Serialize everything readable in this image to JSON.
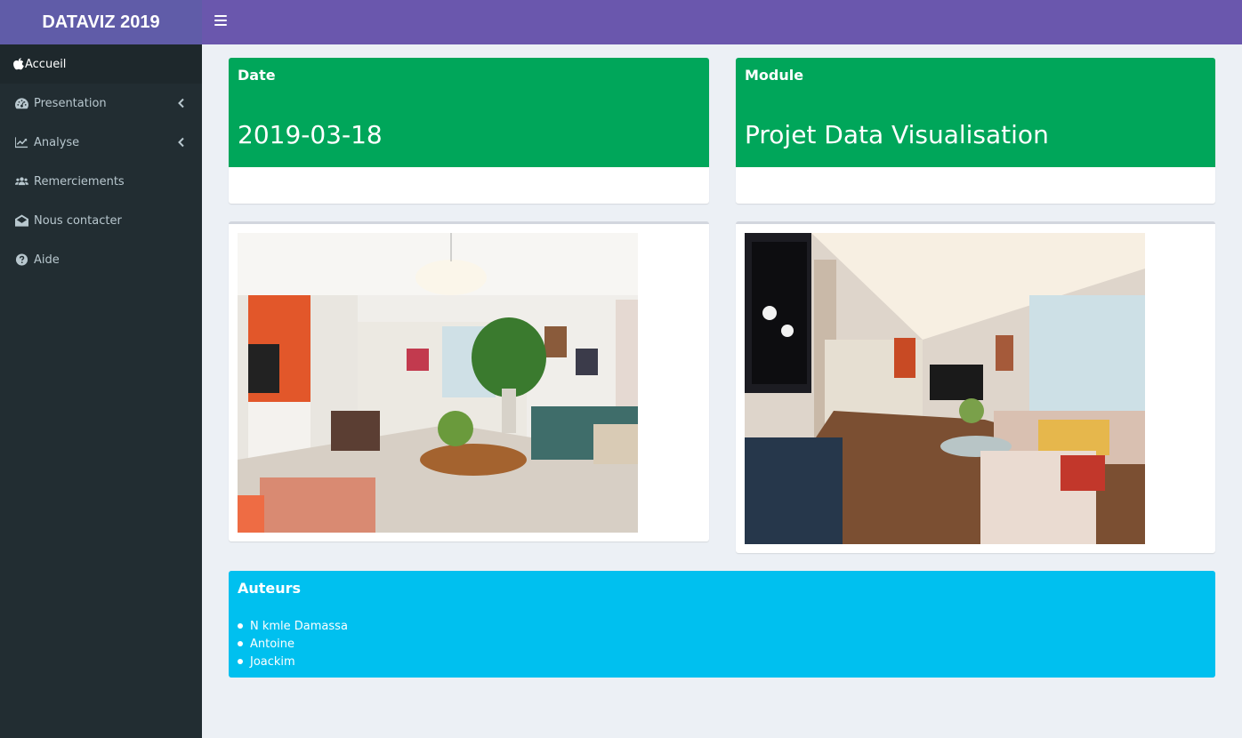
{
  "header": {
    "logo": "DATAVIZ 2019",
    "menu_icon": "hamburger-icon"
  },
  "colors": {
    "header": "#6a57ad",
    "logo_bg": "#605ca8",
    "sidebar": "#222d32",
    "date_box": "#00a65a",
    "authors_box": "#00c0ef"
  },
  "sidebar": {
    "items": [
      {
        "label": "Accueil",
        "icon": "apple-icon",
        "active": true
      },
      {
        "label": "Presentation",
        "icon": "dashboard-icon",
        "submenu": true
      },
      {
        "label": "Analyse",
        "icon": "line-chart-icon",
        "submenu": true
      },
      {
        "label": "Remerciements",
        "icon": "users-icon"
      },
      {
        "label": "Nous contacter",
        "icon": "envelope-open-icon"
      },
      {
        "label": "Aide",
        "icon": "question-circle-icon"
      }
    ]
  },
  "main": {
    "date_box": {
      "label": "Date",
      "value": "2019-03-18"
    },
    "module_box": {
      "label": "Module",
      "value": "Projet Data Visualisation"
    },
    "images": [
      {
        "alt": "living-room-photo-1"
      },
      {
        "alt": "living-room-photo-2"
      }
    ],
    "authors": {
      "title": "Auteurs",
      "list": [
        "N kmle Damassa",
        "Antoine",
        "Joackim"
      ]
    }
  }
}
